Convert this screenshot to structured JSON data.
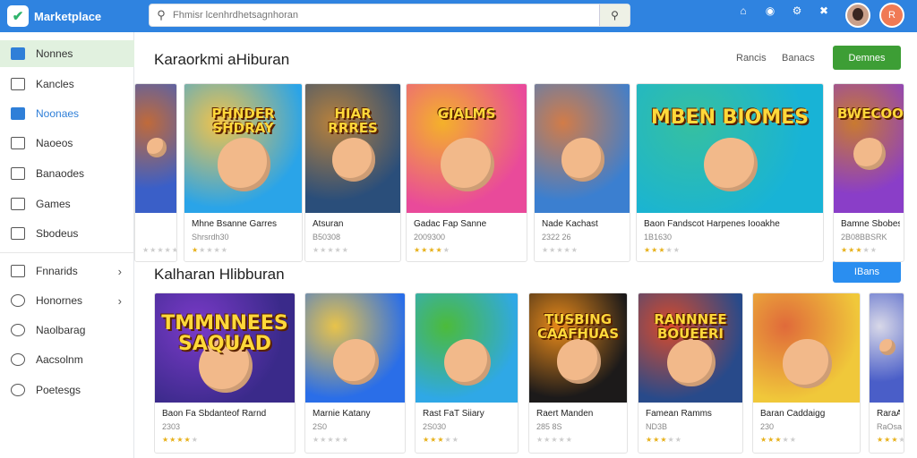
{
  "app": {
    "title": "Marketplace"
  },
  "search": {
    "placeholder": "Fhmisr lcenhrdhetsagnhoran"
  },
  "topbar": {
    "icons": [
      {
        "name": "home-icon",
        "glyph": "⌂"
      },
      {
        "name": "bell-icon",
        "glyph": "🔔"
      },
      {
        "name": "settings-icon",
        "glyph": "⚙"
      },
      {
        "name": "tools-icon",
        "glyph": "✖"
      }
    ],
    "avatar2_letter": "R"
  },
  "sidebar": {
    "items": [
      {
        "label": "Nonnes",
        "state": "active"
      },
      {
        "label": "Kancles",
        "state": ""
      },
      {
        "label": "Noonaes",
        "state": "blue"
      },
      {
        "label": "Naoeos",
        "state": ""
      },
      {
        "label": "Banaodes",
        "state": ""
      },
      {
        "label": "Games",
        "state": ""
      },
      {
        "label": "Sbodeus",
        "state": ""
      },
      {
        "label": "Fnnarids",
        "state": "",
        "chevron": "›"
      },
      {
        "label": "Honornes",
        "state": "",
        "chevron": "›"
      },
      {
        "label": "Naolbarag",
        "state": ""
      },
      {
        "label": "Aacsolnm",
        "state": ""
      },
      {
        "label": "Poetesgs",
        "state": ""
      }
    ]
  },
  "section1": {
    "title": "Karaorkmi aHiburan",
    "link1": "Rancis",
    "link2": "Banacs",
    "button": "Demnes"
  },
  "section2": {
    "title": "Kalharan Hlibburan",
    "button": "IBans"
  },
  "colors": {
    "topbar": "#2f83e0",
    "green_button": "#3d9e35",
    "blue_button": "#2a8ef0",
    "sidebar_active": "#e1f1df",
    "star": "#e7b019"
  },
  "row1": [
    {
      "name": "",
      "downloads": "",
      "rating": 0,
      "art_title": "",
      "bg": "#3a5fc8",
      "bg2": "#c06a3a"
    },
    {
      "name": "Mhne Bsanne Garres",
      "downloads": "Shrsrdh30",
      "rating": 1,
      "art_title": "PHNDER SHDRAY",
      "bg": "#2aa4e8",
      "bg2": "#f2c34a"
    },
    {
      "name": "Atsuran",
      "downloads": "B50308",
      "rating": 0,
      "art_title": "HIAR RRRES",
      "bg": "#2a4e7a",
      "bg2": "#b8813b"
    },
    {
      "name": "Gadac Fap Sanne",
      "downloads": "2009300",
      "rating": 4,
      "art_title": "GIALMS",
      "bg": "#e94a9a",
      "bg2": "#f4b12a"
    },
    {
      "name": "Nade Kachast",
      "downloads": "2322 26",
      "rating": 0,
      "art_title": "",
      "bg": "#3b7fd0",
      "bg2": "#d27c48"
    },
    {
      "name": "Baon Fandscot Harpenes Iooakhe",
      "downloads": "1B1630",
      "rating": 3,
      "art_title": "MBEN BIOMES",
      "bg": "#18b3d6",
      "bg2": "#36c0a0"
    },
    {
      "name": "Bamne Sbobes",
      "downloads": "2B08BBSRK",
      "rating": 3,
      "art_title": "BWECOORS",
      "bg": "#8a3ec8",
      "bg2": "#c97a30"
    }
  ],
  "row2": [
    {
      "name": "Baon Fa Sbdanteof Rarnd",
      "downloads": "2303",
      "rating": 4,
      "art_title": "TMMNNEES SAQUAD",
      "bg": "#3a2a8a",
      "bg2": "#7a3ac8"
    },
    {
      "name": "Marnie Katany",
      "downloads": "2S0",
      "rating": 0,
      "art_title": "",
      "bg": "#2a6ee8",
      "bg2": "#e8c34a"
    },
    {
      "name": "Rast FaT Siiary",
      "downloads": "2S030",
      "rating": 3,
      "art_title": "",
      "bg": "#2fa8e6",
      "bg2": "#4cbb3a"
    },
    {
      "name": "Raert Manden",
      "downloads": "285 8S",
      "rating": 0,
      "art_title": "TUSBING CAAFHUAS",
      "bg": "#1c1a1a",
      "bg2": "#e88a1a"
    },
    {
      "name": "Famean Ramms",
      "downloads": "ND3B",
      "rating": 3,
      "art_title": "RANNNEE BOUEERI",
      "bg": "#284a8a",
      "bg2": "#d84a2a"
    },
    {
      "name": "Baran Caddaigg",
      "downloads": "230",
      "rating": 3,
      "art_title": "",
      "bg": "#f0c83a",
      "bg2": "#e06a3a"
    },
    {
      "name": "RaraAr",
      "downloads": "RaOsa",
      "rating": 3,
      "art_title": "",
      "bg": "#4a5ec8",
      "bg2": "#d8d8e8"
    }
  ]
}
